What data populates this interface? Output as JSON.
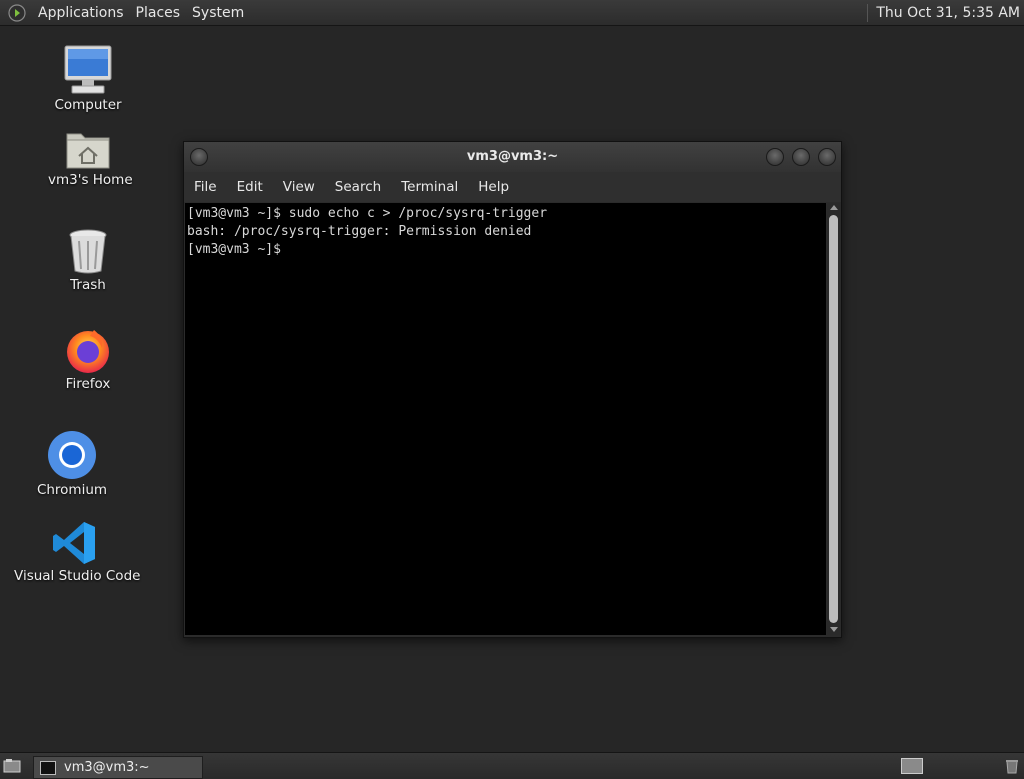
{
  "top_panel": {
    "applications": "Applications",
    "places": "Places",
    "system": "System",
    "clock": "Thu Oct 31,  5:35 AM"
  },
  "desktop_icons": [
    {
      "label": "Computer",
      "icon": "computer-icon"
    },
    {
      "label": "vm3's Home",
      "icon": "home-folder-icon"
    },
    {
      "label": "Trash",
      "icon": "trash-icon"
    },
    {
      "label": "Firefox",
      "icon": "firefox-icon"
    },
    {
      "label": "Chromium",
      "icon": "chromium-icon"
    },
    {
      "label": "Visual Studio Code",
      "icon": "vscode-icon"
    }
  ],
  "terminal": {
    "title": "vm3@vm3:~",
    "menu": [
      "File",
      "Edit",
      "View",
      "Search",
      "Terminal",
      "Help"
    ],
    "lines": [
      "[vm3@vm3 ~]$ sudo echo c > /proc/sysrq-trigger",
      "bash: /proc/sysrq-trigger: Permission denied",
      "[vm3@vm3 ~]$ "
    ]
  },
  "taskbar": {
    "window_label": "vm3@vm3:~"
  }
}
